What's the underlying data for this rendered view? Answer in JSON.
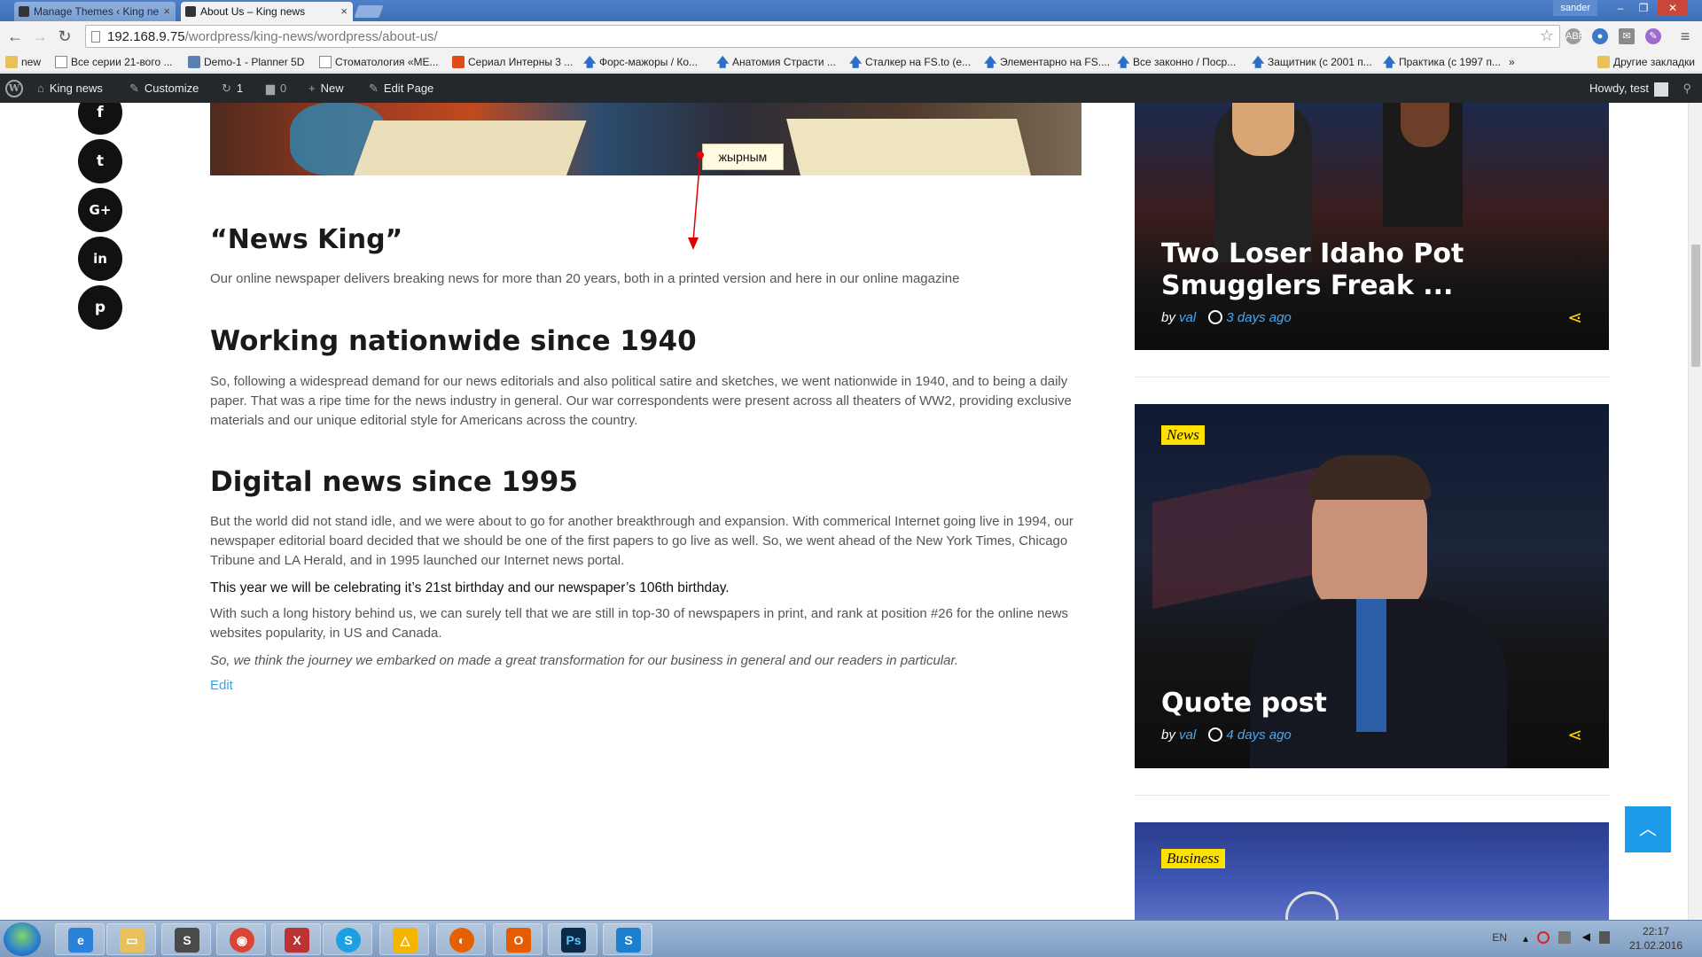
{
  "browser": {
    "tabs": [
      {
        "title": "Manage Themes ‹ King ne",
        "active": false
      },
      {
        "title": "About Us – King news",
        "active": true
      }
    ],
    "window_user": "sander",
    "url_host": "192.168.9.75",
    "url_path": "/wordpress/king-news/wordpress/about-us/",
    "bookmarks": [
      {
        "label": "new",
        "icon": "folder"
      },
      {
        "label": "Все серии 21-вого ...",
        "icon": "page"
      },
      {
        "label": "Demo-1 - Planner 5D",
        "icon": "square"
      },
      {
        "label": "Стоматология «МЕ...",
        "icon": "page"
      },
      {
        "label": "Сериал Интерны 3 ...",
        "icon": "red"
      },
      {
        "label": "Форс-мажоры / Ко...",
        "icon": "arrow"
      },
      {
        "label": "Анатомия Страсти ...",
        "icon": "arrow"
      },
      {
        "label": "Сталкер на FS.to (e...",
        "icon": "arrow"
      },
      {
        "label": "Элементарно на FS....",
        "icon": "arrow"
      },
      {
        "label": "Все законно / Поср...",
        "icon": "arrow"
      },
      {
        "label": "Защитник (с 2001 п...",
        "icon": "arrow"
      },
      {
        "label": "Практика (с 1997 п...",
        "icon": "arrow"
      }
    ],
    "bookmarks_overflow": "»",
    "other_bookmarks": "Другие закладки"
  },
  "adminbar": {
    "site_name": "King news",
    "customize": "Customize",
    "updates_count": "1",
    "comments_count": "0",
    "new_label": "New",
    "edit_page": "Edit Page",
    "howdy": "Howdy, test"
  },
  "social": [
    "f",
    "t",
    "G+",
    "in",
    "p"
  ],
  "annotation": {
    "callout_text": "жырным",
    "color": "#e00000"
  },
  "article": {
    "heading_main": "“News King”",
    "intro": "Our online newspaper delivers breaking news for more than 20 years, both in a printed version and here in our online magazine",
    "heading_1940": "Working nationwide since 1940",
    "para_1940": "So, following a widespread demand for our news editorials and also political satire and sketches, we went nationwide in 1940, and to being a daily paper. That was a ripe time for the news industry in general. Our war correspondents were present across all theaters of WW2, providing exclusive materials and our unique editorial style for Americans across the country.",
    "heading_1995": "Digital news since 1995",
    "para_1995": "But the world did not stand idle, and we were about to go for another breakthrough and expansion. With commerical Internet going live in 1994, our newspaper editorial board decided that we should be one of the first papers to go live as well. So, we went ahead of the New York Times, Chicago Tribune and LA Herald, and in 1995 launched our Internet news portal.",
    "highlight": "This year we will be celebrating it’s 21st birthday and our newspaper’s 106th birthday.",
    "para_history": "With such a long history behind us, we can surely tell that we are still in top-30 of newspapers in print, and rank at position #26 for the online news websites popularity, in US and Canada.",
    "closing": "So, we think the journey we embarked on made a great transformation for our business in general and our readers in particular.",
    "edit_link": "Edit"
  },
  "sidebar": {
    "cards": [
      {
        "title": "Two Loser Idaho Pot Smugglers Freak ...",
        "by": "by",
        "author": "val",
        "time": "3 days ago",
        "category": ""
      },
      {
        "title": "Quote post",
        "by": "by",
        "author": "val",
        "time": "4 days ago",
        "category": "News"
      },
      {
        "title": "",
        "by": "",
        "author": "",
        "time": "",
        "category": "Business"
      }
    ]
  },
  "taskbar": {
    "language": "EN",
    "time": "22:17",
    "date": "21.02.2016",
    "apps": [
      "ie",
      "explorer",
      "sublime",
      "chrome",
      "xcv",
      "skype",
      "drive",
      "firefox",
      "office",
      "photoshop",
      "skype-s"
    ]
  },
  "colors": {
    "accent_blue": "#1e9be8",
    "badge_yellow": "#ffe100",
    "adminbar": "#23282d"
  }
}
